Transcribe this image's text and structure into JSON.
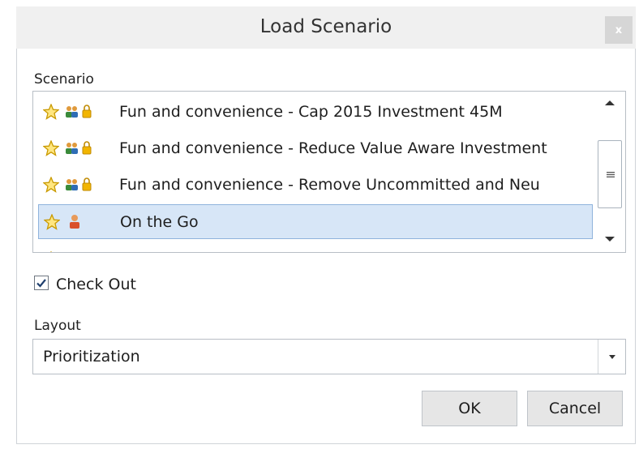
{
  "dialog": {
    "title": "Load Scenario",
    "close_label": "x"
  },
  "scenario": {
    "label": "Scenario",
    "items": [
      {
        "label": "Fun and convenience - Cap 2015 Investment 45M",
        "icons": [
          "star-icon",
          "group-icon",
          "lock-icon"
        ],
        "selected": false
      },
      {
        "label": "Fun and convenience - Reduce Value Aware Investment",
        "icons": [
          "star-icon",
          "group-icon",
          "lock-icon"
        ],
        "selected": false
      },
      {
        "label": "Fun and convenience - Remove Uncommitted and Neu",
        "icons": [
          "star-icon",
          "group-icon",
          "lock-icon"
        ],
        "selected": false
      },
      {
        "label": "On the Go",
        "icons": [
          "star-icon",
          "person-icon"
        ],
        "selected": true
      }
    ]
  },
  "checkout": {
    "label": "Check Out",
    "checked": true
  },
  "layout": {
    "label": "Layout",
    "value": "Prioritization"
  },
  "buttons": {
    "ok": "OK",
    "cancel": "Cancel"
  },
  "colors": {
    "selection_bg": "#d7e6f7",
    "selection_border": "#8fb3dc",
    "star": "#f4c400",
    "lock": "#f2b500",
    "person": "#d9502c"
  }
}
